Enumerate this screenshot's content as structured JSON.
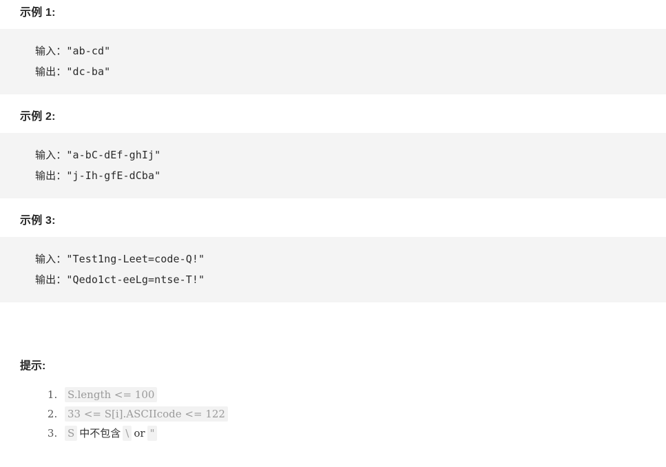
{
  "examples": [
    {
      "heading": "示例 1:",
      "input_label": "输入：",
      "input_value": "\"ab-cd\"",
      "output_label": "输出：",
      "output_value": "\"dc-ba\""
    },
    {
      "heading": "示例 2:",
      "input_label": "输入：",
      "input_value": "\"a-bC-dEf-ghIj\"",
      "output_label": "输出：",
      "output_value": "\"j-Ih-gfE-dCba\""
    },
    {
      "heading": "示例 3:",
      "input_label": "输入：",
      "input_value": "\"Test1ng-Leet=code-Q!\"",
      "output_label": "输出：",
      "output_value": "\"Qedo1ct-eeLg=ntse-T!\""
    }
  ],
  "hints": {
    "heading": "提示:",
    "items": [
      {
        "code": "S.length <= 100"
      },
      {
        "code": "33 <= S[i].ASCIIcode <= 122"
      },
      {
        "code_1": "S",
        "text_1": "中不包含",
        "code_2": "\\",
        "text_2": "or",
        "code_3": "\""
      }
    ]
  },
  "colors": {
    "block_background": "#f4f4f4",
    "inline_code_background": "#f2f2f2",
    "heading_text": "#262626",
    "code_text": "#2b2b2b",
    "hint_text": "#555555",
    "inline_code_text": "#9a9a9a",
    "page_background": "#ffffff"
  }
}
